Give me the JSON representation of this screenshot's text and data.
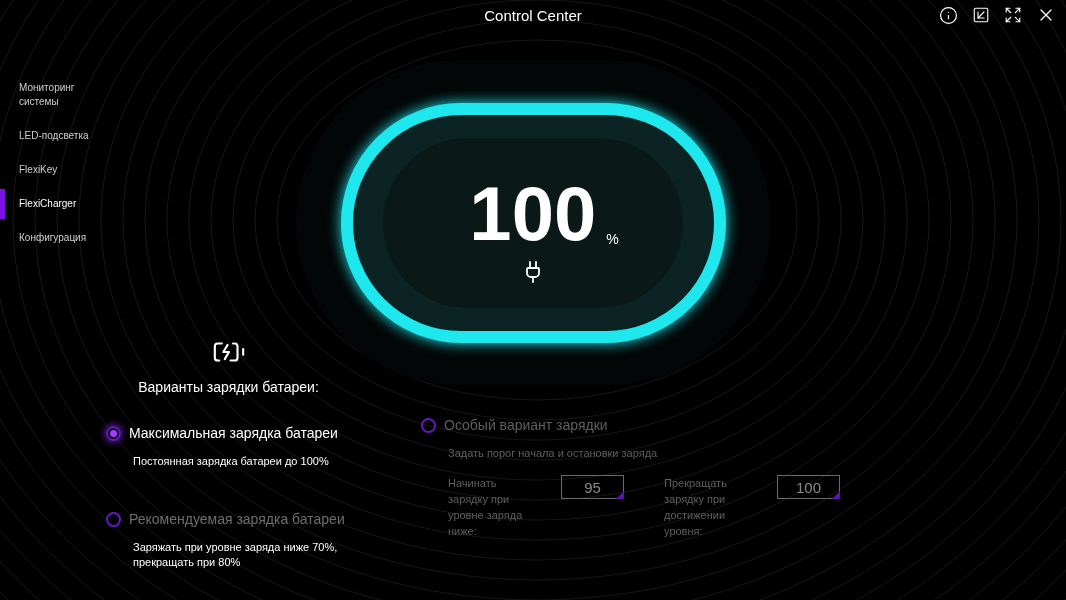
{
  "window": {
    "title": "Control Center"
  },
  "sidebar": {
    "items": [
      {
        "label": "Мониторинг системы",
        "selected": false
      },
      {
        "label": "LED-подсветка",
        "selected": false
      },
      {
        "label": "FlexiKey",
        "selected": false
      },
      {
        "label": "FlexiCharger",
        "selected": true
      },
      {
        "label": "Конфигурация",
        "selected": false
      }
    ]
  },
  "battery": {
    "value": "100",
    "unit": "%",
    "plugged": true
  },
  "charging_options": {
    "heading": "Варианты зарядки батареи:",
    "options": [
      {
        "kind": "simple",
        "label": "Максимальная зарядка батареи",
        "description": "Постоянная зарядка батареи до 100%",
        "selected": true
      },
      {
        "kind": "simple",
        "label": "Рекомендуемая зарядка батареи",
        "description": "Заряжать при уровне заряда ниже 70%, прекращать при 80%",
        "selected": false
      },
      {
        "kind": "custom",
        "label": "Особый вариант зарядки",
        "description": "Задать порог начала и остановки заряда",
        "selected": false,
        "disabled": true,
        "fields": [
          {
            "label": "Начинать зарядку при уровне заряда ниже:",
            "value": "95"
          },
          {
            "label": "Прекращать зарядку при достижении уровня:",
            "value": "100"
          }
        ]
      }
    ]
  }
}
